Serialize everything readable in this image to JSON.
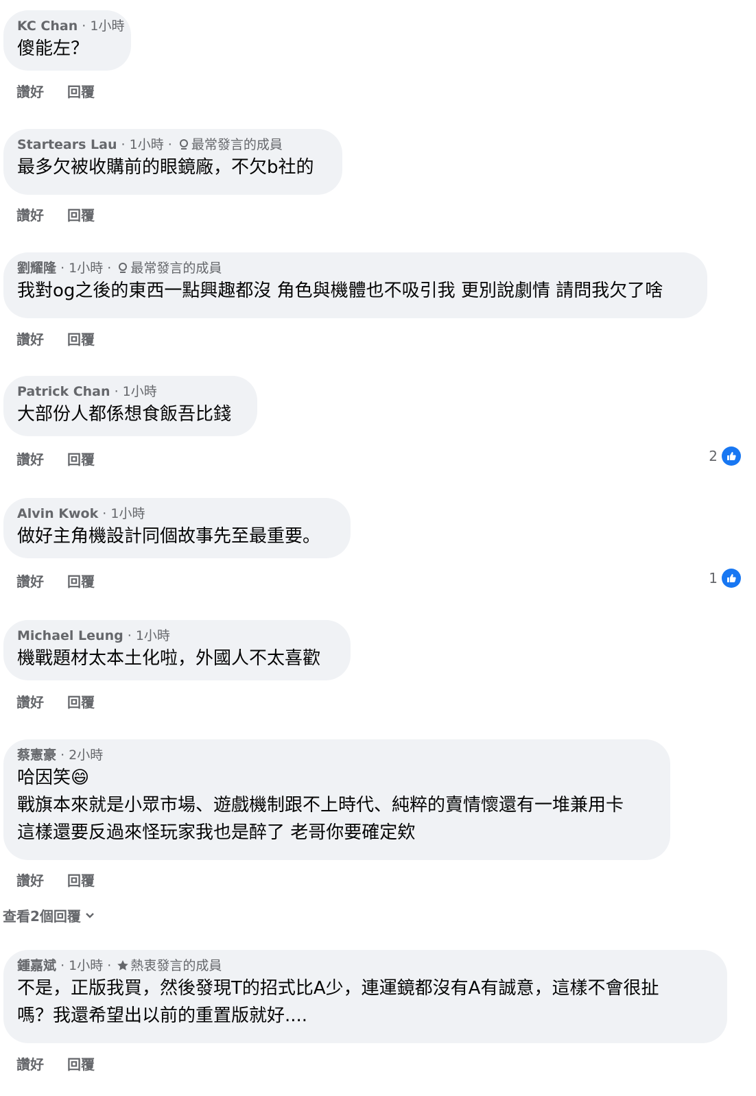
{
  "action_labels": {
    "like": "讚好",
    "reply": "回覆"
  },
  "comments": [
    {
      "name": "KC Chan",
      "time": "· 1小時",
      "badge": "",
      "text": "傻能左？"
    },
    {
      "name": "Startears Lau",
      "time": "· 1小時 ·",
      "badge": "最常發言的成員",
      "text": "最多欠被收購前的眼鏡廠，不欠b社的"
    },
    {
      "name": "劉耀隆",
      "time": "· 1小時 ·",
      "badge": "最常發言的成員",
      "text": "我對og之後的東西一點興趣都沒 角色與機體也不吸引我 更別說劇情 請問我欠了啥"
    },
    {
      "name": "Patrick Chan",
      "time": "· 1小時",
      "badge": "",
      "text": "大部份人都係想食飯吾比錢",
      "likes": "2"
    },
    {
      "name": "Alvin Kwok",
      "time": "· 1小時",
      "badge": "",
      "text": "做好主角機設計同個故事先至最重要。",
      "likes": "1"
    },
    {
      "name": "Michael Leung",
      "time": "· 1小時",
      "badge": "",
      "text": "機戰題材太本土化啦，外國人不太喜歡"
    },
    {
      "name": "蔡憲豪",
      "time": "· 2小時",
      "badge": "",
      "text": "哈因笑😄\n戰旗本來就是小眾市場、遊戲機制跟不上時代、純粹的賣情懷還有一堆兼用卡\n這樣還要反過來怪玩家我也是醉了 老哥你要確定欸"
    },
    {
      "name": "鍾嘉斌",
      "time": "· 1小時 ·",
      "badge": "熱衷發言的成員",
      "text": "不是，正版我買，然後發現T的招式比A少，連運鏡都沒有A有誠意，這樣不會很扯\n嗎？我還希望出以前的重置版就好...."
    }
  ],
  "view_replies": "查看2個回覆",
  "icons": {
    "badge_top": "award-icon",
    "badge_fan": "star-icon",
    "like": "thumbs-up-icon",
    "expand": "chevron-down-icon"
  },
  "colors": {
    "like_blue": "#1877f2",
    "bubble": "#f0f2f5",
    "meta": "#65676b"
  }
}
